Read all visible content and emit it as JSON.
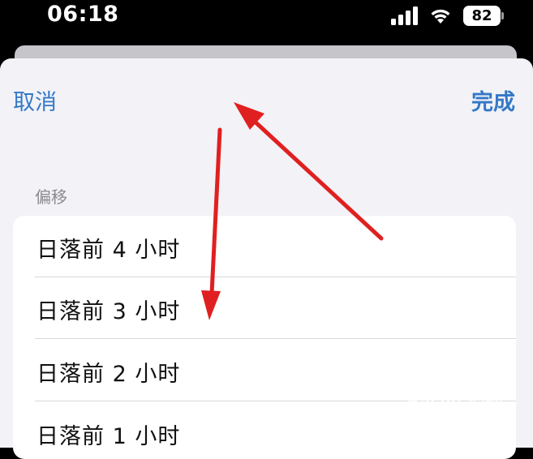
{
  "status": {
    "time": "06:18",
    "battery": "82",
    "icons": [
      "signal-icon",
      "wifi-icon",
      "battery-icon"
    ]
  },
  "header": {
    "cancel_label": "取消",
    "done_label": "完成"
  },
  "section": {
    "title": "偏移"
  },
  "options": [
    {
      "label": "日落前 4 小时"
    },
    {
      "label": "日落前 3 小时"
    },
    {
      "label": "日落前 2 小时"
    },
    {
      "label": "日落前 1 小时"
    }
  ],
  "annotation": {
    "arrow_color": "#e02020",
    "arrow_count": 2
  },
  "watermark": {
    "logo": "Bai du 经验",
    "site": "jingyan.baidu.com"
  },
  "colors": {
    "accent": "#3478c6",
    "sheet_bg": "#f2f2f7"
  }
}
